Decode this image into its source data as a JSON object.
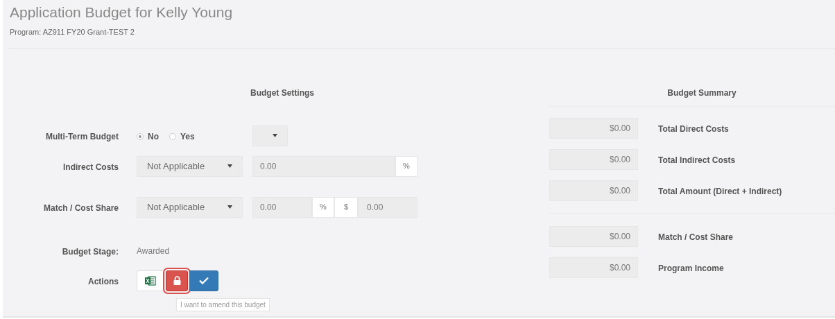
{
  "title": "Application Budget for Kelly Young",
  "program": "Program: AZ911 FY20 Grant-TEST 2",
  "settings": {
    "heading": "Budget Settings",
    "multi_term": {
      "label": "Multi-Term Budget",
      "options": [
        {
          "label": "No",
          "selected": true
        },
        {
          "label": "Yes",
          "selected": false
        }
      ]
    },
    "indirect_costs": {
      "label": "Indirect Costs",
      "select": "Not Applicable",
      "rate": "0.00",
      "unit": "%"
    },
    "match": {
      "label": "Match / Cost Share",
      "select": "Not Applicable",
      "rate": "0.00",
      "unit": "%",
      "currency": "$",
      "amount": "0.00"
    },
    "stage": {
      "label": "Budget Stage:",
      "value": "Awarded"
    },
    "actions": {
      "label": "Actions",
      "buttons": [
        {
          "kind": "excel",
          "focused": false
        },
        {
          "kind": "lock",
          "focused": true
        },
        {
          "kind": "check",
          "focused": false
        }
      ],
      "tooltip": "I want to amend this budget"
    }
  },
  "summary": {
    "heading": "Budget Summary",
    "groups": [
      [
        {
          "value": "$0.00",
          "label": "Total Direct Costs"
        },
        {
          "value": "$0.00",
          "label": "Total Indirect Costs"
        },
        {
          "value": "$0.00",
          "label": "Total Amount (Direct + Indirect)"
        }
      ],
      [
        {
          "value": "$0.00",
          "label": "Match / Cost Share"
        },
        {
          "value": "$0.00",
          "label": "Program Income"
        }
      ]
    ]
  }
}
